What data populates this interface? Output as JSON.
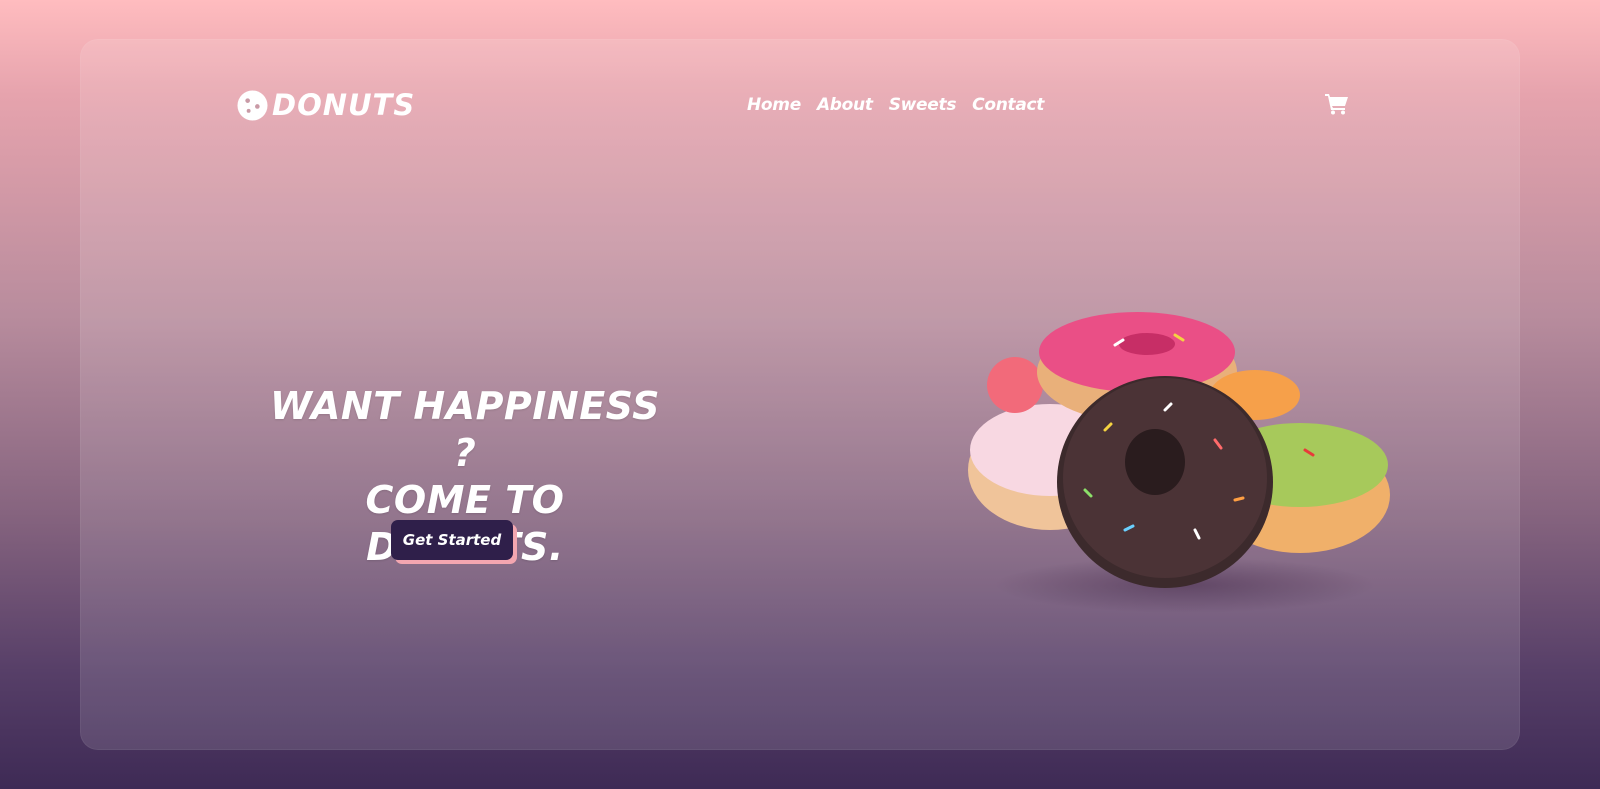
{
  "brand": {
    "name": "DONUTS",
    "logo_icon": "donut-icon"
  },
  "nav": {
    "items": [
      "Home",
      "About",
      "Sweets",
      "Contact"
    ]
  },
  "header": {
    "cart_icon": "cart-icon"
  },
  "hero": {
    "title_line1": "WANT HAPPINESS ?",
    "title_line2": "COME TO DONUTS.",
    "cta_label": "Get Started",
    "image": "donuts-stack-image"
  },
  "colors": {
    "gradient_top": "#ffbcbf",
    "gradient_bottom": "#3e2a55",
    "button_bg": "#2f1f4a",
    "button_shadow": "#f3a6b0"
  }
}
